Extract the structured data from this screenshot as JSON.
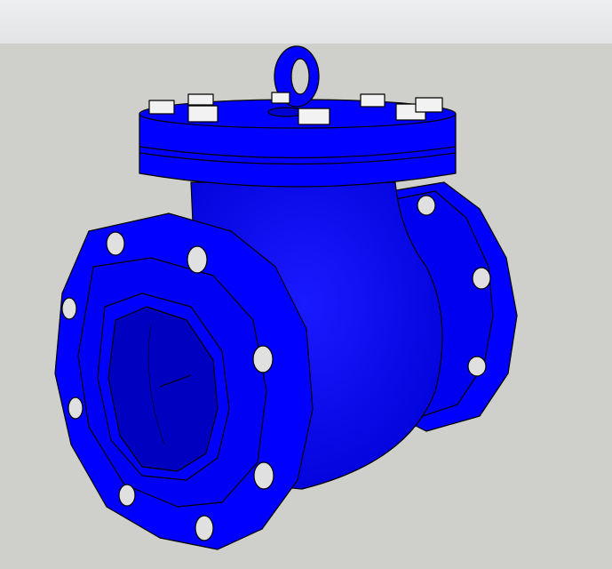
{
  "scene": {
    "model": "swing-check-valve",
    "colors": {
      "sky": "#e6e8e9",
      "ground": "#cfcfcb",
      "body": "#0000ff",
      "body_shade": "#0000c8",
      "edge": "#000000",
      "bolt": "#f2f2f2",
      "hole": "#e0e0e0"
    }
  }
}
